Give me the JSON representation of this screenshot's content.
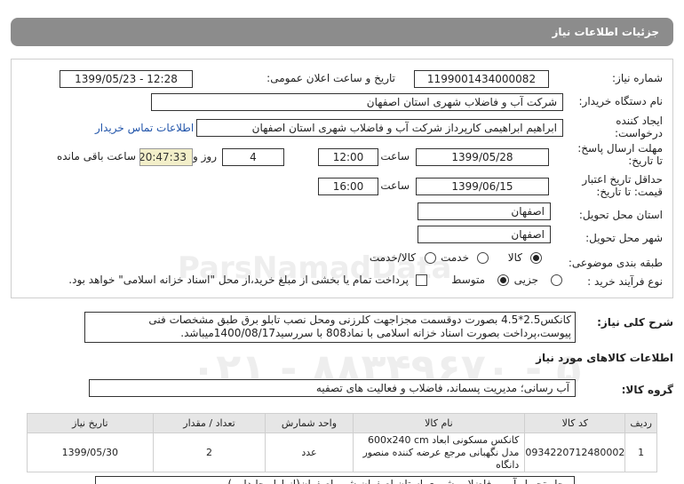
{
  "header": {
    "title": "جزئیات اطلاعات نیاز"
  },
  "form": {
    "need_number_label": "شماره نیاز:",
    "need_number": "1199001434000082",
    "announce_label": "تاریخ و ساعت اعلان عمومی:",
    "announce_value": "1399/05/23 - 12:28",
    "buyer_org_label": "نام دستگاه خریدار:",
    "buyer_org": "شرکت آب و فاضلاب شهری استان اصفهان",
    "requester_label": "ایجاد کننده درخواست:",
    "requester": "ابراهیم ابراهیمی کارپرداز شرکت آب و فاضلاب شهری استان اصفهان",
    "contact_link": "اطلاعات تماس خریدار",
    "reply_deadline_label": "مهلت ارسال پاسخ: تا تاریخ:",
    "reply_date": "1399/05/28",
    "time_label": "ساعت",
    "reply_time": "12:00",
    "days_value": "4",
    "days_label": "روز و",
    "timer": "20:47:33",
    "remaining_label": "ساعت باقی مانده",
    "validity_label": "حداقل تاریخ اعتبار قیمت: تا تاریخ:",
    "validity_date": "1399/06/15",
    "validity_time_label": "ساعت",
    "validity_time": "16:00",
    "province_label": "استان محل تحویل:",
    "province": "اصفهان",
    "city_label": "شهر محل تحویل:",
    "city": "اصفهان",
    "category_label": "طبقه بندی موضوعی:",
    "category_options": [
      "کالا",
      "خدمت",
      "کالا/خدمت"
    ],
    "process_label": "نوع فرآیند خرید :",
    "process_options": [
      "جزیی",
      "متوسط"
    ],
    "payment_note": "پرداخت تمام یا بخشی از مبلغ خرید،از محل \"اسناد خزانه اسلامی\" خواهد بود."
  },
  "summary": {
    "label": "شرح کلی نیاز:",
    "text": "کانکس2.5*4.5 بصورت دوقسمت مجزاجهت کلرزنی ومحل نصب تابلو برق طبق مشخصات فنی پیوست،پرداخت بصورت اسناد خزانه اسلامی با نماد808 با سررسید1400/08/17میباشد."
  },
  "goods": {
    "section_title": "اطلاعات کالاهای مورد نیاز",
    "group_label": "گروه کالا:",
    "group_value": "آب رسانی؛ مدیریت پسماند، فاضلاب و فعالیت های تصفیه",
    "columns": [
      "ردیف",
      "کد کالا",
      "نام کالا",
      "واحد شمارش",
      "تعداد / مقدار",
      "تاریخ نیاز"
    ],
    "rows": [
      {
        "row": "1",
        "code": "0934220712480002",
        "name": "کانکس مسکونی ابعاد 600x240 cm مدل نگهبانی مرجع عرضه کننده منصور دانگاه",
        "unit": "عدد",
        "qty": "2",
        "date": "1399/05/30"
      }
    ]
  },
  "footer_partial": "محل تحویل آب و فاضلاب شهری استان اصفهان شهر اصفهان(از اول جابدایی)"
}
